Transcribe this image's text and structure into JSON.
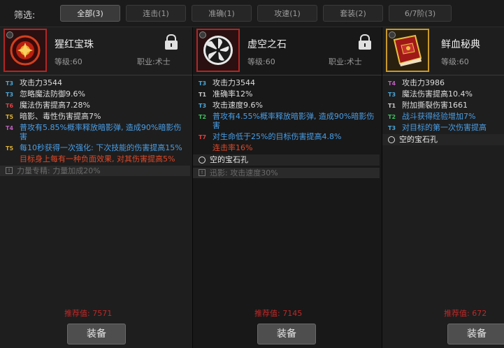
{
  "filter": {
    "label": "筛选:",
    "tabs": [
      {
        "label": "全部(3)"
      },
      {
        "label": "连击(1)"
      },
      {
        "label": "准确(1)"
      },
      {
        "label": "攻速(1)"
      },
      {
        "label": "套装(2)"
      },
      {
        "label": "6/7阶(3)"
      }
    ]
  },
  "cards": [
    {
      "name": "猩红宝珠",
      "level": "等级:60",
      "job": "职业:术士",
      "attrs": [
        {
          "tier": "T3",
          "text": "攻击力3544",
          "color": "white"
        },
        {
          "tier": "T3",
          "text": "忽略魔法防御9.6%",
          "color": "white"
        },
        {
          "tier": "T6",
          "text": "魔法伤害提高7.28%",
          "color": "white"
        },
        {
          "tier": "T5",
          "text": "暗影、毒性伤害提高7%",
          "color": "white"
        },
        {
          "tier": "T4",
          "text": "普攻有5.85%概率释放暗影弹, 造成90%暗影伤害",
          "color": "blue"
        },
        {
          "tier": "T5",
          "text": "每10秒获得一次强化: 下次技能的伤害提高15%",
          "color": "blue"
        },
        {
          "tier": "",
          "text": "目标身上每有一种负面效果, 对其伤害提高5%",
          "color": "red"
        }
      ],
      "passive": "力量专精: 力量加成20%",
      "recommend": "推荐值: 7571",
      "equip": "装备"
    },
    {
      "name": "虚空之石",
      "level": "等级:60",
      "job": "职业:术士",
      "attrs": [
        {
          "tier": "T3",
          "text": "攻击力3544",
          "color": "white"
        },
        {
          "tier": "T1",
          "text": "准确率12%",
          "color": "white"
        },
        {
          "tier": "T3",
          "text": "攻击速度9.6%",
          "color": "white"
        },
        {
          "tier": "T2",
          "text": "普攻有4.55%概率释放暗影弹, 造成90%暗影伤害",
          "color": "blue"
        },
        {
          "tier": "T7",
          "text": "对生命低于25%的目标伤害提高4.8%",
          "color": "blue"
        },
        {
          "tier": "",
          "text": "连击率16%",
          "color": "red"
        }
      ],
      "gem": "空的宝石孔",
      "passive": "迅影: 攻击速度30%",
      "recommend": "推荐值: 7145",
      "equip": "装备"
    },
    {
      "name": "鲜血秘典",
      "level": "等级:60",
      "attrs": [
        {
          "tier": "T4",
          "text": "攻击力3986",
          "color": "white"
        },
        {
          "tier": "T3",
          "text": "魔法伤害提高10.4%",
          "color": "white"
        },
        {
          "tier": "T1",
          "text": "附加撕裂伤害1661",
          "color": "white"
        },
        {
          "tier": "T2",
          "text": "战斗获得经验增加7%",
          "color": "blue"
        },
        {
          "tier": "T3",
          "text": "对目标的第一次伤害提高",
          "color": "blue"
        }
      ],
      "gem": "空的宝石孔",
      "recommend": "推荐值: 672",
      "equip": "装备"
    }
  ],
  "colors": {
    "accent_red": "#c02828",
    "tier_blue": "#4aa6d8",
    "frame_gold": "#c99a2a"
  },
  "icons": {
    "lock": "lock-open-icon",
    "orb": "crimson-orb-icon",
    "stone": "void-stone-icon",
    "book": "blood-tome-icon"
  }
}
